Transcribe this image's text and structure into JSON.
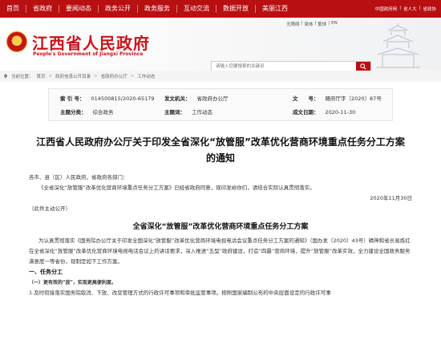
{
  "topnav": {
    "items": [
      "首页",
      "省政府",
      "要闻动态",
      "政务公开",
      "政务服务",
      "互动交流",
      "数据开放",
      "美丽江西"
    ],
    "right_links": [
      "中国政府网",
      "省人大",
      "省政协"
    ]
  },
  "header": {
    "title": "江西省人民政府",
    "subtitle": "People's Government of Jiangxi Province",
    "links": [
      "无障碍",
      "简体",
      "繁体",
      "EN"
    ],
    "search": {
      "placeholder": "请输入您要搜索的关键词"
    }
  },
  "breadcrumb": {
    "prefix": "当前位置：",
    "items": [
      "首页",
      "政府信息公开目录",
      "省政府办公厅",
      "工作动态"
    ]
  },
  "meta": {
    "index_label": "索 引 号：",
    "index_value": "014500815/2020-65179",
    "issuer_label": "发文机关：",
    "issuer_value": "省政府办公厅",
    "docno_label": "文　　号：",
    "docno_value": "赣府厅字〔2020〕87号",
    "category_label": "主题分类：",
    "category_value": "综合政务",
    "topic_label": "主题词：",
    "topic_value": "工作动态",
    "date_label": "成文日期：",
    "date_value": "2020-11-30"
  },
  "article": {
    "title": "江西省人民政府办公厅关于印发全省深化“放管服”改革优化营商环境重点任务分工方案的通知",
    "salutation": "各市、县（区）人民政府，省政府各部门：",
    "para1": "《全省深化“放管服”改革优化营商环境重点任务分工方案》已经省政府同意，现印发给你们，请结合实际认真贯彻落实。",
    "date": "2020年11月30日",
    "note": "（此件主动公开）",
    "subtitle": "全省深化“放管服”改革优化营商环境重点任务分工方案",
    "para2": "为认真贯彻落实《国务院办公厅关于印发全国深化“放管服”改革优化营商环境电视电话会议重点任务分工方案的通知》（国办发〔2020〕43号）精神和省长易炼红在全省深化“放管服”改革优化营商环境电视电话会议上的讲话要求，深入推进“五型”政府建设，打造“四最”营商环境，提升“放管服”改革实效，全力建设全国政务服务满意度一等省份，现制定如下工作方案。",
    "section1": "一、任务分工",
    "subsection1": "（一）更有效的“放”，实现更高便利度。",
    "item1": "1.及时衔接落实国务院取消、下放、改变管理方式的行政许可事项和审批监管事项。按照国家编制公布的中央层面设定的行政许可事"
  }
}
